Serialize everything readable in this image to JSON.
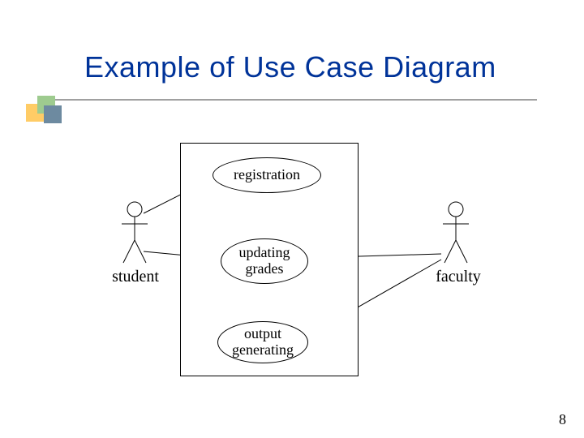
{
  "title": "Example of Use Case Diagram",
  "actors": {
    "left": "student",
    "right": "faculty"
  },
  "usecases": {
    "uc1": "registration",
    "uc2": "updating\ngrades",
    "uc3": "output\ngenerating"
  },
  "page_number": "8"
}
